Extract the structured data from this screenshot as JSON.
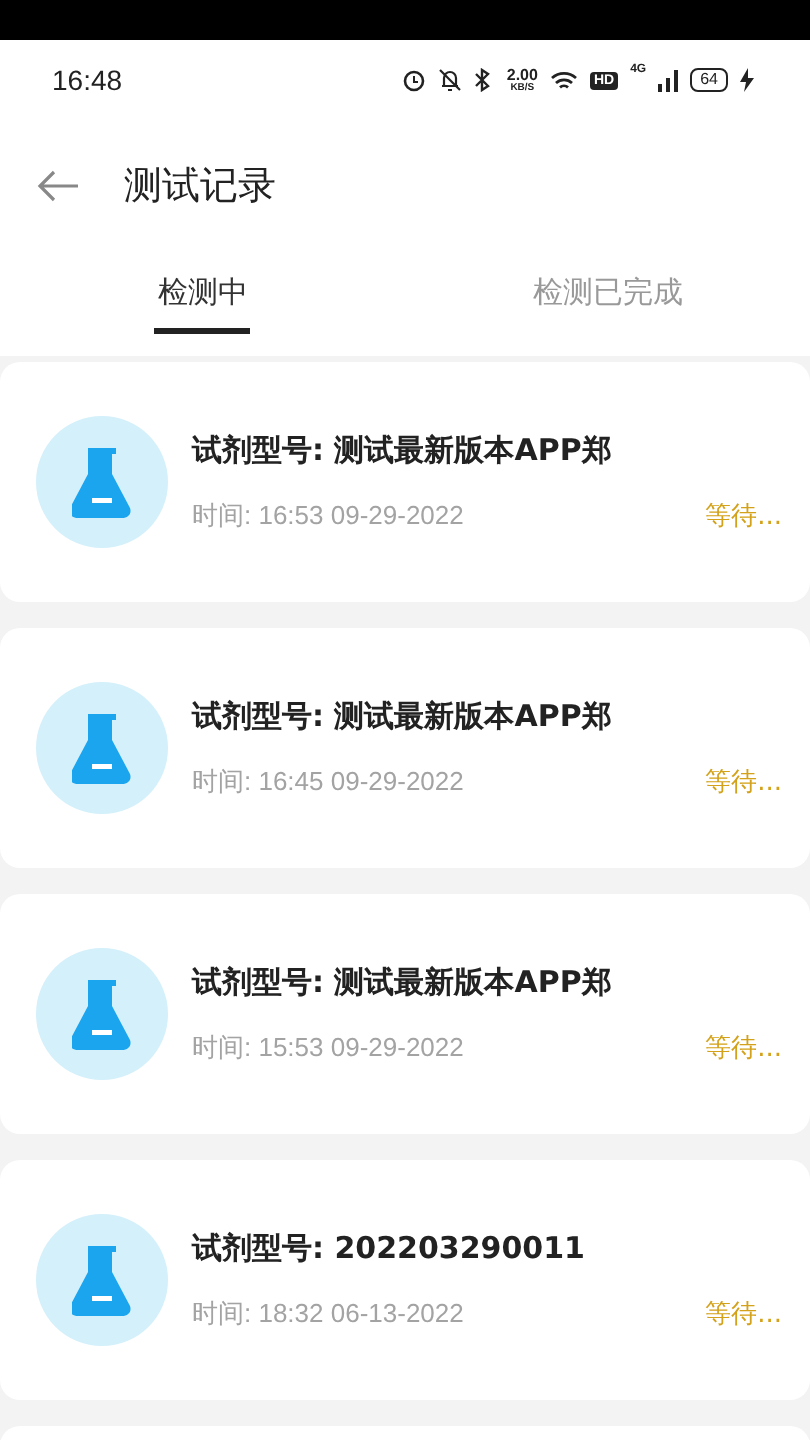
{
  "status_bar": {
    "time": "16:48",
    "speed_value": "2.00",
    "speed_unit": "KB/S",
    "hd": "HD",
    "network": "4G",
    "battery": "64"
  },
  "header": {
    "title": "测试记录"
  },
  "tabs": [
    {
      "label": "检测中",
      "selected": true
    },
    {
      "label": "检测已完成",
      "selected": false
    }
  ],
  "records": [
    {
      "title": "试剂型号: 测试最新版本APP郑",
      "time": "时间: 16:53 09-29-2022",
      "status": "等待..."
    },
    {
      "title": "试剂型号: 测试最新版本APP郑",
      "time": "时间: 16:45 09-29-2022",
      "status": "等待..."
    },
    {
      "title": "试剂型号: 测试最新版本APP郑",
      "time": "时间: 15:53 09-29-2022",
      "status": "等待..."
    },
    {
      "title": "试剂型号: 202203290011",
      "time": "时间: 18:32 06-13-2022",
      "status": "等待..."
    }
  ]
}
